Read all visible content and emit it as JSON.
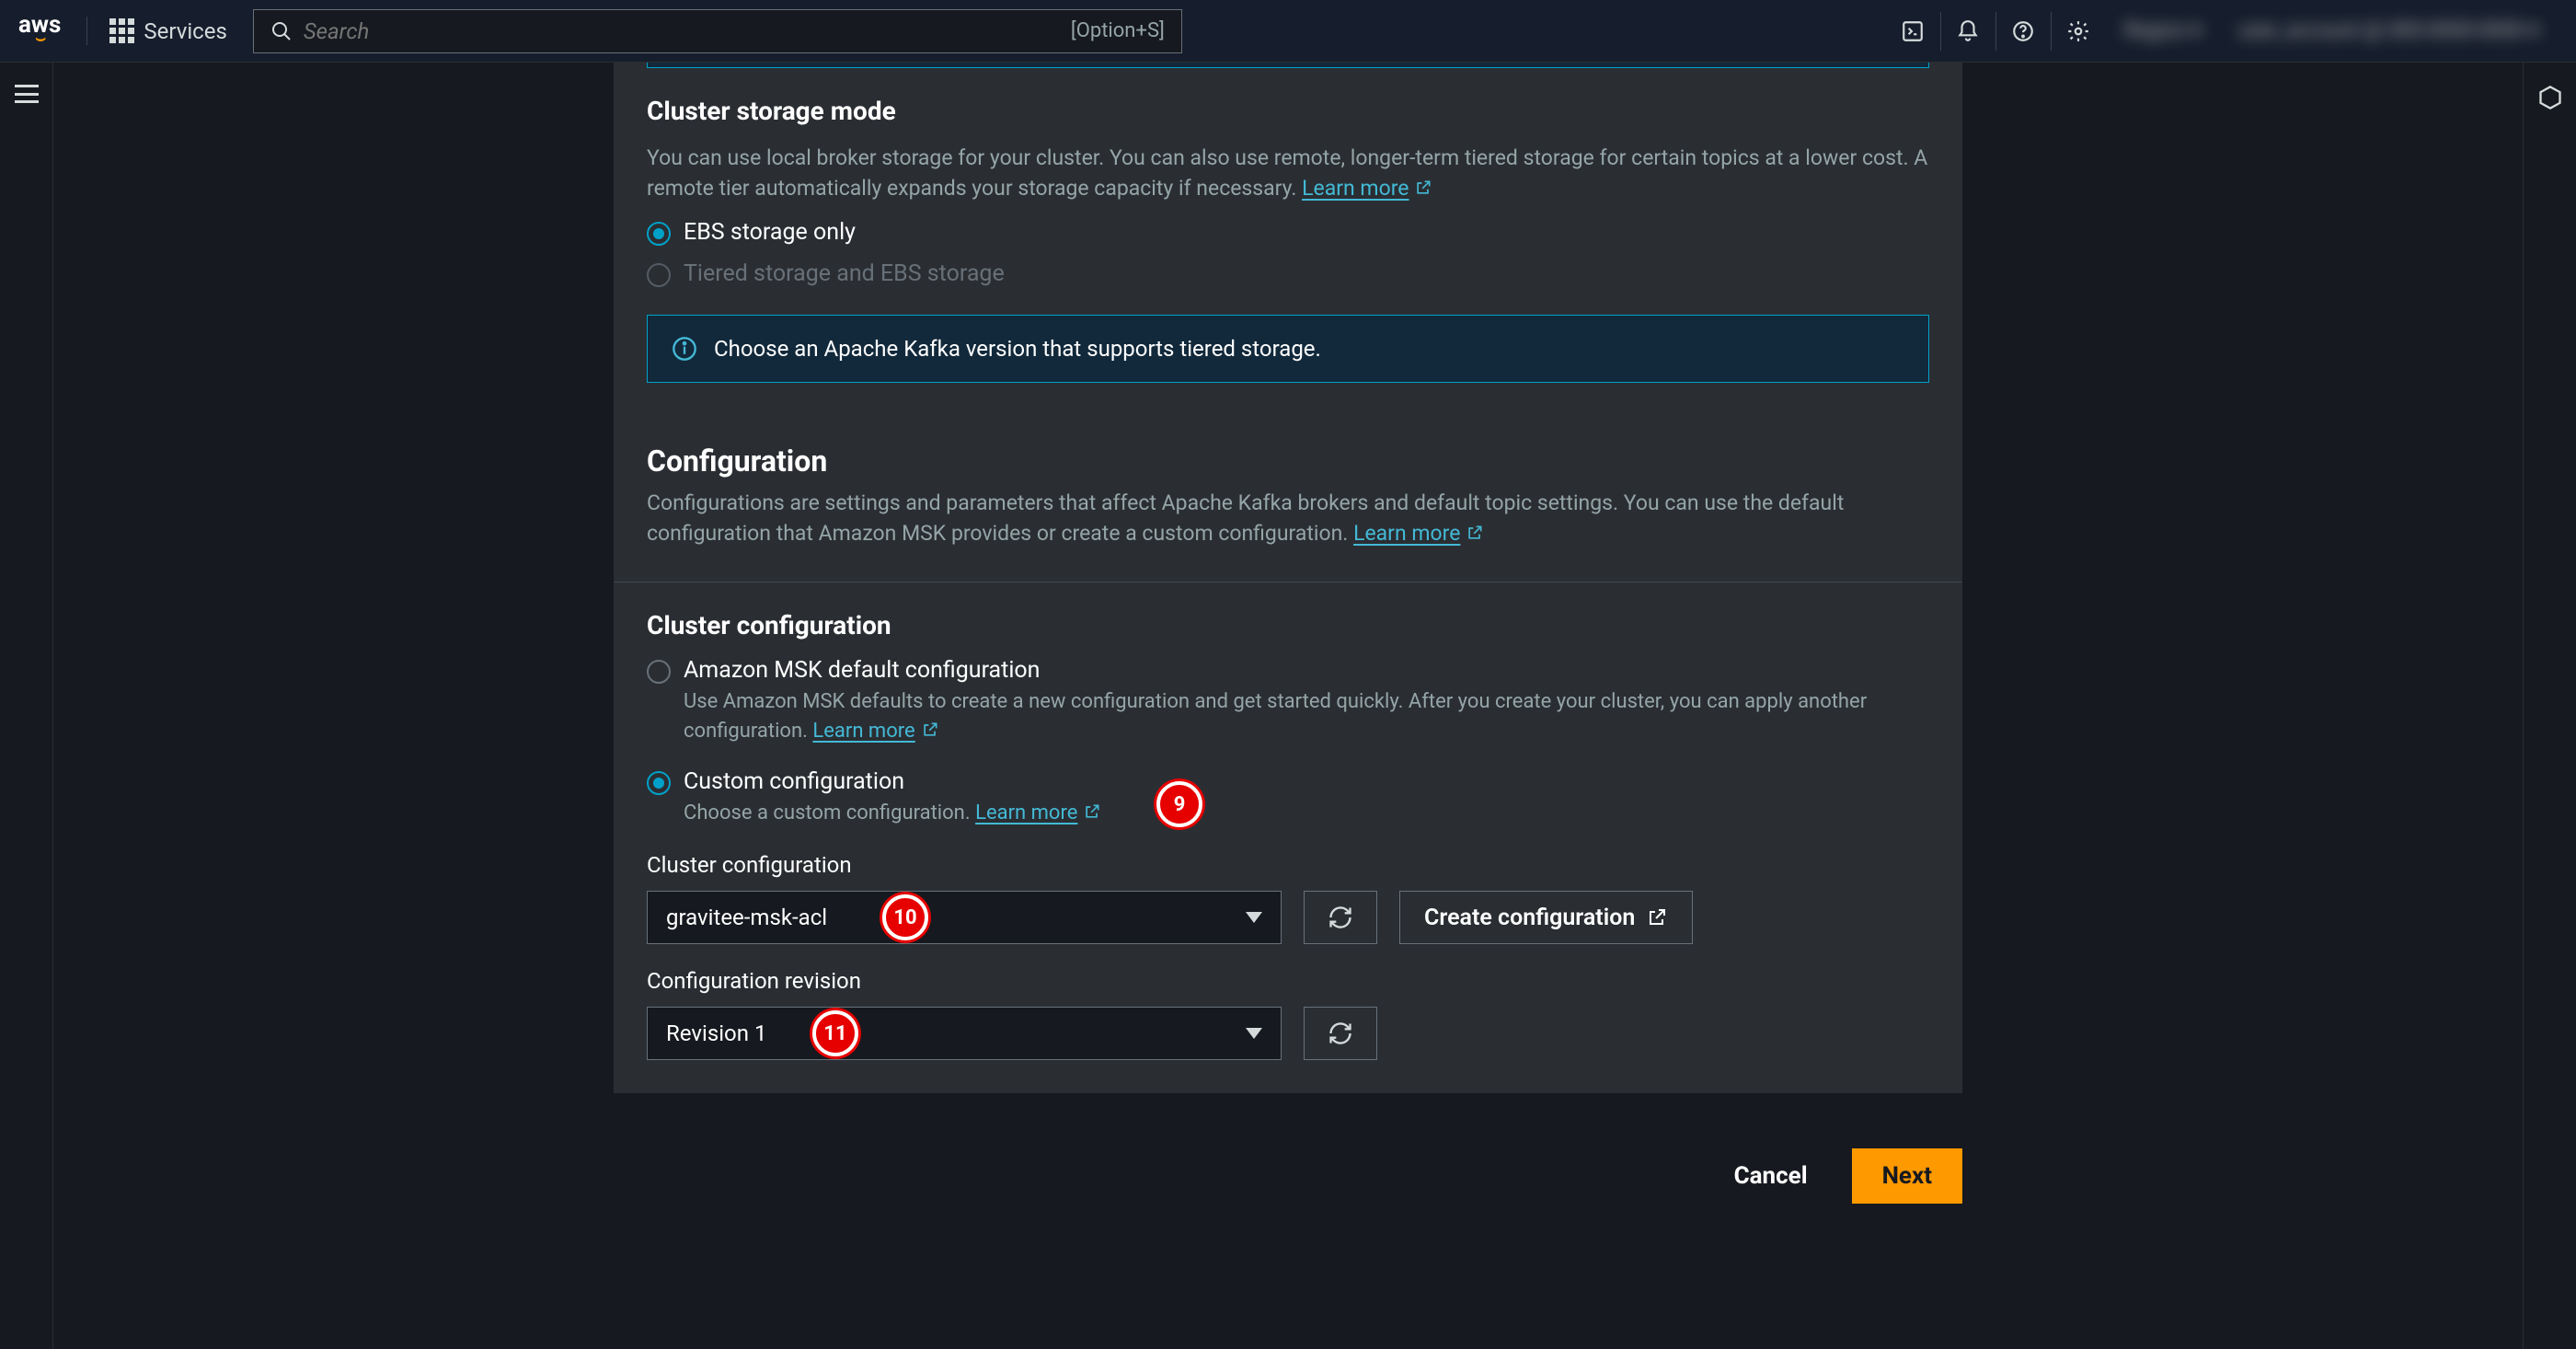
{
  "topnav": {
    "logo": "aws",
    "services": "Services",
    "search_placeholder": "Search",
    "search_shortcut": "[Option+S]"
  },
  "storage": {
    "heading": "Cluster storage mode",
    "desc_a": "You can use local broker storage for your cluster. You can also use remote, longer-term tiered storage for certain topics at a lower cost. A remote tier automatically expands your storage capacity if necessary. ",
    "learn_more": "Learn more",
    "option_ebs": "EBS storage only",
    "option_tiered": "Tiered storage and EBS storage",
    "info_text": "Choose an Apache Kafka version that supports tiered storage."
  },
  "config": {
    "heading": "Configuration",
    "desc": "Configurations are settings and parameters that affect Apache Kafka brokers and default topic settings. You can use the default configuration that Amazon MSK provides or create a custom configuration. ",
    "learn_more": "Learn more",
    "cluster_heading": "Cluster configuration",
    "option_default_label": "Amazon MSK default configuration",
    "option_default_desc": "Use Amazon MSK defaults to create a new configuration and get started quickly. After you create your cluster, you can apply another configuration. ",
    "option_custom_label": "Custom configuration",
    "option_custom_desc": "Choose a custom configuration. ",
    "field_config_label": "Cluster configuration",
    "config_value": "gravitee-msk-acl",
    "create_btn": "Create configuration",
    "field_revision_label": "Configuration revision",
    "revision_value": "Revision 1"
  },
  "footer": {
    "cancel": "Cancel",
    "next": "Next"
  },
  "callouts": {
    "c9": "9",
    "c10": "10",
    "c11": "11"
  }
}
